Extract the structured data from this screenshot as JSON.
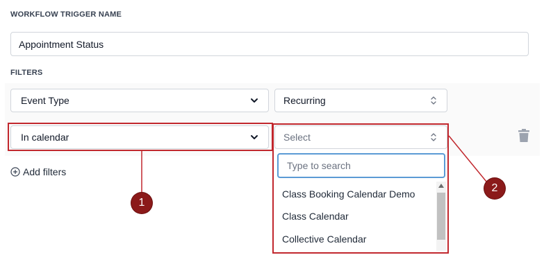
{
  "trigger": {
    "section_label": "WORKFLOW TRIGGER NAME",
    "name_value": "Appointment Status"
  },
  "filters": {
    "section_label": "FILTERS",
    "row1": {
      "field": "Event Type",
      "value": "Recurring"
    },
    "row2": {
      "field": "In calendar",
      "value_placeholder": "Select"
    },
    "add_label": "Add filters"
  },
  "dropdown": {
    "search_placeholder": "Type to search",
    "options": [
      "Class Booking Calendar Demo",
      "Class Calendar",
      "Collective Calendar"
    ]
  },
  "callouts": [
    "1",
    "2"
  ],
  "colors": {
    "annotation_red": "#c1272d",
    "callout_fill": "#8b1a1a",
    "focus_blue": "#5b9bd5"
  }
}
